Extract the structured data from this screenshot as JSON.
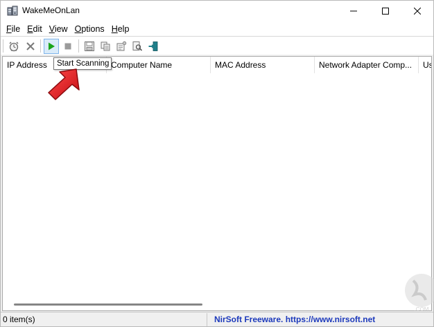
{
  "window": {
    "title": "WakeMeOnLan"
  },
  "menu": [
    {
      "key": "F",
      "rest": "ile"
    },
    {
      "key": "E",
      "rest": "dit"
    },
    {
      "key": "V",
      "rest": "iew"
    },
    {
      "key": "O",
      "rest": "ptions"
    },
    {
      "key": "H",
      "rest": "elp"
    }
  ],
  "toolbar": {
    "tooltip": "Start Scanning",
    "items": [
      "alarm-clock-icon",
      "delete-icon",
      "play-icon",
      "stop-icon",
      "save-icon",
      "copy-icon",
      "properties-icon",
      "find-icon",
      "exit-icon"
    ]
  },
  "list": {
    "columns": [
      "IP Address",
      "Computer Name",
      "MAC Address",
      "Network Adapter Comp...",
      "Use"
    ]
  },
  "status": {
    "count": "0 item(s)",
    "credit": "NirSoft Freeware. https://www.nirsoft.net"
  },
  "colors": {
    "accent": "#1c39bb",
    "arrow": "#e8171e",
    "play": "#1aa51a"
  }
}
